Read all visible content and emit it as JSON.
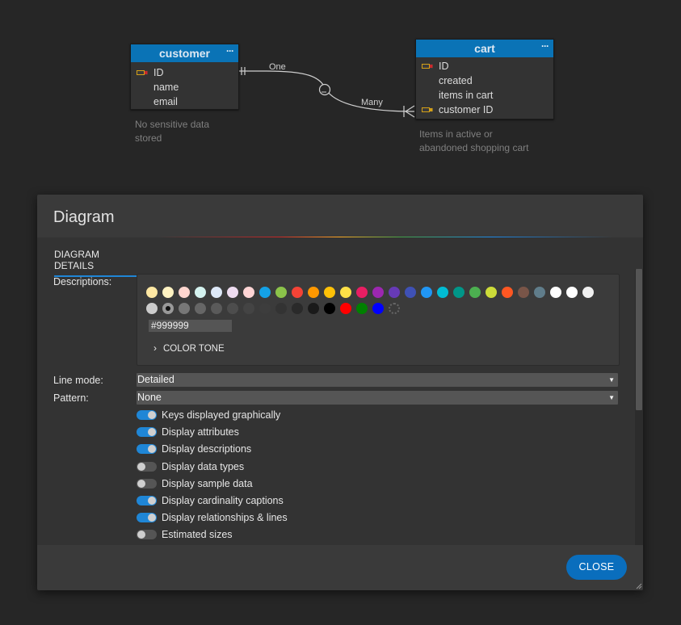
{
  "diagram": {
    "customer": {
      "title": "customer",
      "menu": "···",
      "attributes": [
        {
          "name": "ID",
          "key": "pk"
        },
        {
          "name": "name",
          "key": ""
        },
        {
          "name": "email",
          "key": ""
        }
      ],
      "note_lines": [
        "No sensitive data",
        "stored"
      ]
    },
    "cart": {
      "title": "cart",
      "menu": "···",
      "attributes": [
        {
          "name": "ID",
          "key": "pk"
        },
        {
          "name": "created",
          "key": ""
        },
        {
          "name": "items in cart",
          "key": ""
        },
        {
          "name": "customer ID",
          "key": "fk"
        }
      ],
      "note_lines": [
        "Items in active or",
        "abandoned shopping cart"
      ]
    },
    "relationship": {
      "caption_one": "One",
      "caption_many": "Many"
    }
  },
  "dialog": {
    "title": "Diagram",
    "tab_label": "DIAGRAM DETAILS",
    "descriptions_label": "Descriptions:",
    "color_hex": "#999999",
    "color_tone_label": "COLOR TONE",
    "swatches_row1": [
      "#ffe8a3",
      "#fff2c2",
      "#ffd6cf",
      "#d4f2ef",
      "#dde8f7",
      "#eedcf0",
      "#ffd5d5",
      "#14a1e6",
      "#8bc34a",
      "#f44336",
      "#ff9800",
      "#ffc107",
      "#fde047",
      "#e91e63",
      "#9c27b0",
      "#673ab7",
      "#3f51b5",
      "#2196f3",
      "#00bcd4",
      "#009688",
      "#4caf50",
      "#cddc39",
      "#ff5722",
      "#795548",
      "#607d8b",
      "#ffffff",
      "#ffffff",
      "#f0f0f0"
    ],
    "swatches_row2": [
      "#cccccc",
      "#999999",
      "#777777",
      "#666666",
      "#5a5a5a",
      "#4d4d4d",
      "#444444",
      "#3d3d3d",
      "#333333",
      "#2a2a2a",
      "#1a1a1a",
      "#000000",
      "#ff0000",
      "#008000",
      "#0000ff",
      "pick"
    ],
    "selected_swatch": "#999999",
    "line_mode_label": "Line mode:",
    "line_mode_value": "Detailed",
    "pattern_label": "Pattern:",
    "pattern_value": "None",
    "toggles": [
      {
        "label": "Keys displayed graphically",
        "on": true
      },
      {
        "label": "Display attributes",
        "on": true
      },
      {
        "label": "Display descriptions",
        "on": true
      },
      {
        "label": "Display data types",
        "on": false
      },
      {
        "label": "Display sample data",
        "on": false
      },
      {
        "label": "Display cardinality captions",
        "on": true
      },
      {
        "label": "Display relationships & lines",
        "on": true
      },
      {
        "label": "Estimated sizes",
        "on": false
      }
    ],
    "close_label": "CLOSE"
  }
}
